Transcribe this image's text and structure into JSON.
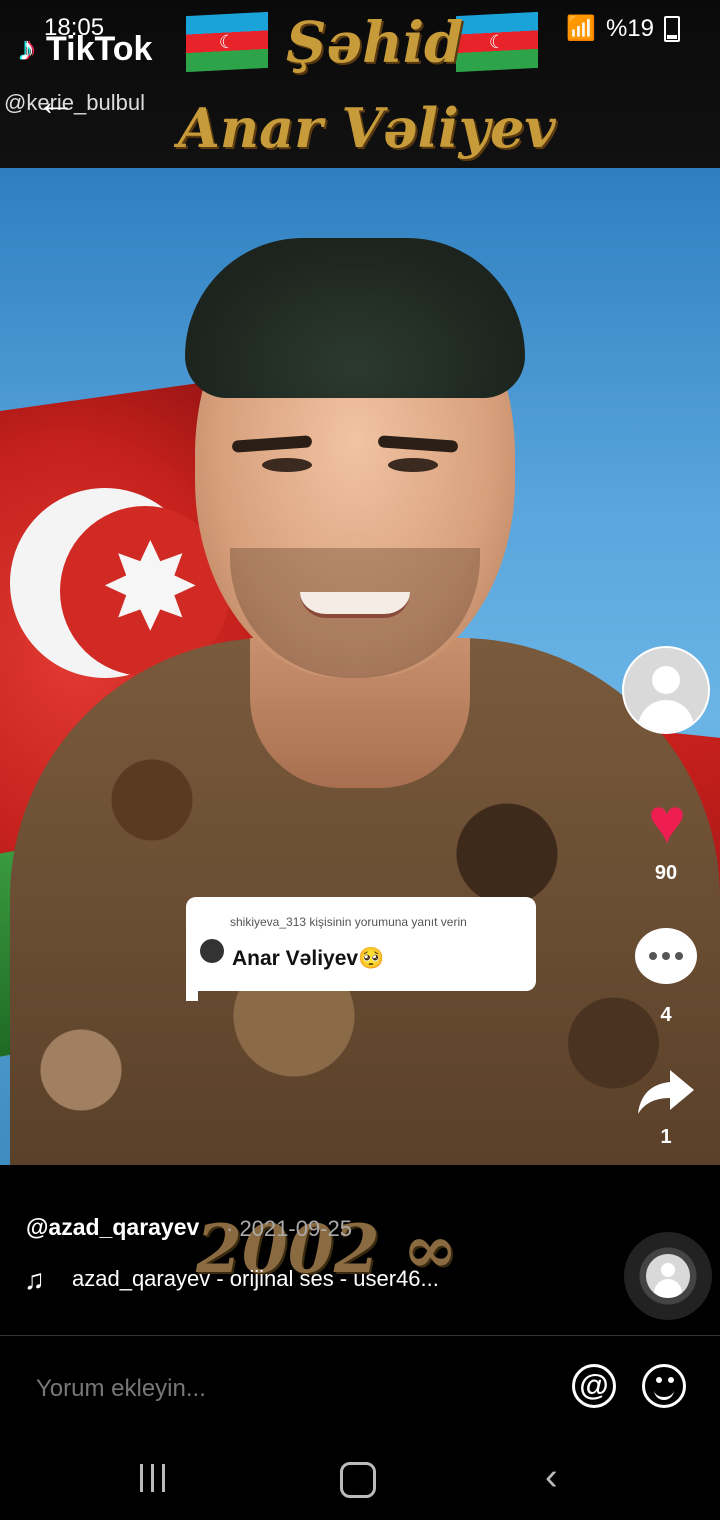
{
  "status_bar": {
    "time": "18:05",
    "battery": "%19"
  },
  "video": {
    "app_logo": "TikTok",
    "watermark_user": "@kerie_bulbul",
    "title_line1": "Şəhid",
    "title_line2": "Anar Vəliyev",
    "year_overlay": "2002 ∞"
  },
  "reply_sticker": {
    "header": "shikiyeva_313 kişisinin yorumuna yanıt verin",
    "text": "Anar Vəliyev🥺"
  },
  "actions": {
    "likes": "90",
    "comments": "4",
    "shares": "1",
    "like_color": "#ee1d52"
  },
  "caption": {
    "username": "@azad_qarayev",
    "date": "· 2021-09-25",
    "music": "azad_qarayev - orijinal ses - user46..."
  },
  "comment_bar": {
    "placeholder": "Yorum ekleyin..."
  },
  "icons": {
    "back": "back-arrow-icon",
    "at": "at-mention-icon",
    "emoji": "emoji-icon",
    "music": "music-note-icon"
  }
}
